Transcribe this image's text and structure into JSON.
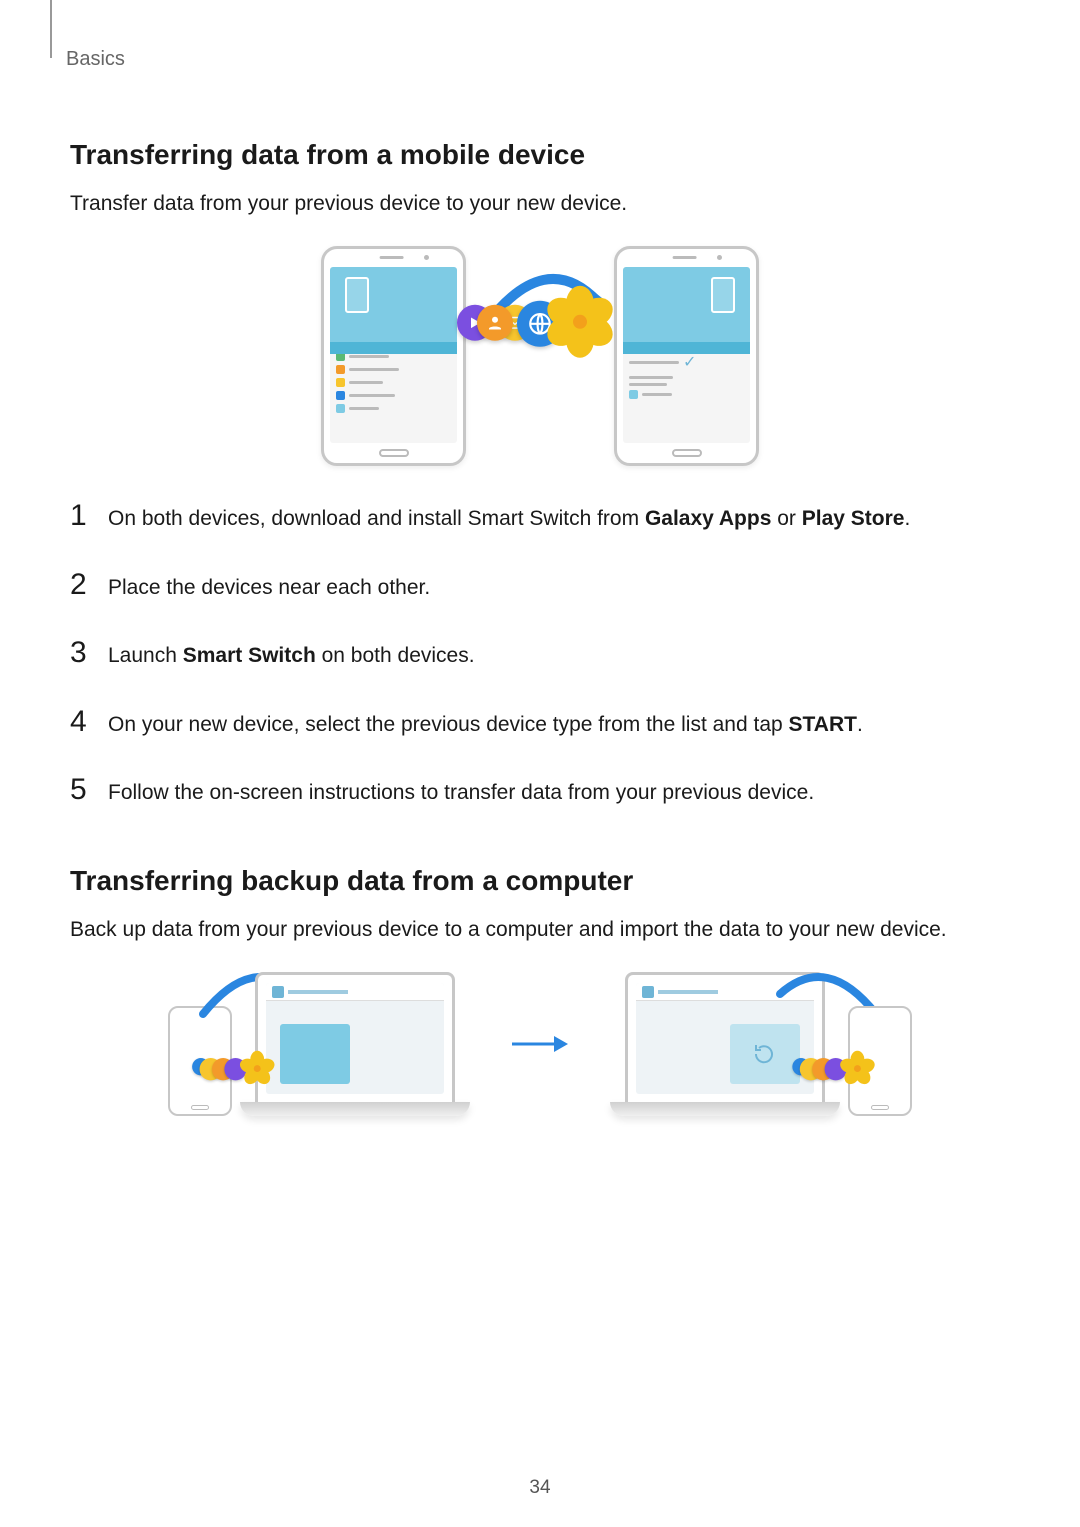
{
  "breadcrumb": "Basics",
  "section1": {
    "title": "Transferring data from a mobile device",
    "intro": "Transfer data from your previous device to your new device.",
    "steps": {
      "s1": {
        "num": "1",
        "pre": "On both devices, download and install Smart Switch from ",
        "b1": "Galaxy Apps",
        "mid": " or ",
        "b2": "Play Store",
        "post": "."
      },
      "s2": {
        "num": "2",
        "text": "Place the devices near each other."
      },
      "s3": {
        "num": "3",
        "pre": "Launch ",
        "b1": "Smart Switch",
        "post": " on both devices."
      },
      "s4": {
        "num": "4",
        "pre": "On your new device, select the previous device type from the list and tap ",
        "b1": "START",
        "post": "."
      },
      "s5": {
        "num": "5",
        "text": "Follow the on-screen instructions to transfer data from your previous device."
      }
    }
  },
  "section2": {
    "title": "Transferring backup data from a computer",
    "intro": "Back up data from your previous device to a computer and import the data to your new device."
  },
  "pageNumber": "34",
  "icons": {
    "contacts": "contacts-icon",
    "mail": "mail-icon",
    "video": "video-icon",
    "globe": "globe-icon",
    "transfer": "transfer-arrow-icon"
  }
}
